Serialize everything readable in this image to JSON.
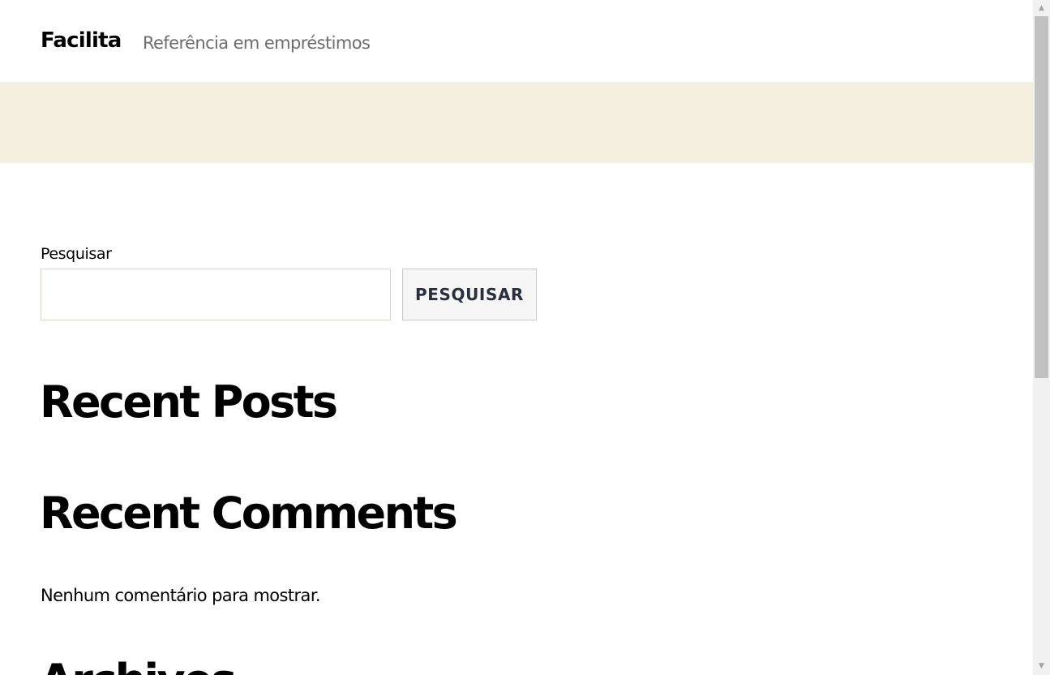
{
  "header": {
    "site_title": "Facilita",
    "tagline": "Referência em empréstimos"
  },
  "search": {
    "label": "Pesquisar",
    "input_value": "",
    "placeholder": "",
    "button_label": "Pesquisar"
  },
  "widgets": {
    "recent_posts_title": "Recent Posts",
    "recent_comments_title": "Recent Comments",
    "no_comments_text": "Nenhum comentário para mostrar.",
    "archives_title": "Archives"
  },
  "scrollbar": {
    "up_arrow_icon": "▲",
    "down_arrow_icon": "▼"
  },
  "colors": {
    "cover_band": "#f5efe0",
    "tagline": "#6d6d6d",
    "button_text": "#28303d"
  }
}
